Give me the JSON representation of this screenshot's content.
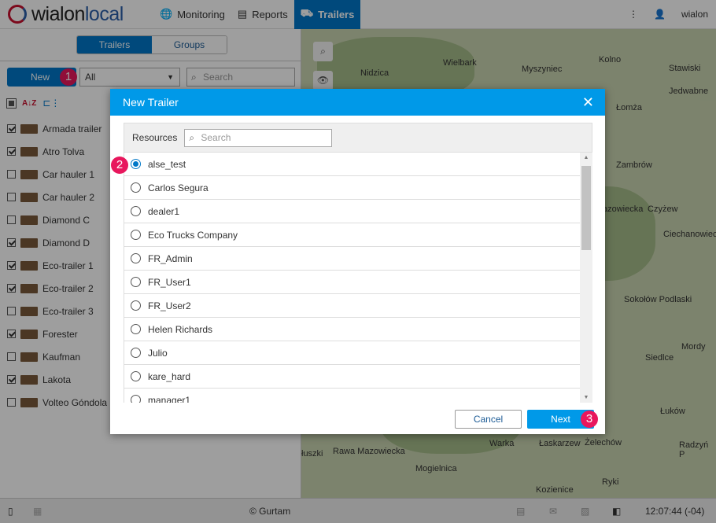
{
  "header": {
    "logo": "wialon",
    "logo_accent": "local",
    "nav": [
      {
        "label": "Monitoring",
        "icon": "globe-icon"
      },
      {
        "label": "Reports",
        "icon": "clipboard-icon"
      },
      {
        "label": "Trailers",
        "icon": "trailer-icon"
      }
    ],
    "user": "wialon"
  },
  "panel": {
    "tabs": [
      "Trailers",
      "Groups"
    ],
    "new_label": "New",
    "filter": "All",
    "search_placeholder": "Search",
    "items": [
      {
        "name": "Armada trailer",
        "checked": true
      },
      {
        "name": "Atro Tolva",
        "checked": true
      },
      {
        "name": "Car hauler 1",
        "checked": false
      },
      {
        "name": "Car hauler 2",
        "checked": false
      },
      {
        "name": "Diamond C",
        "checked": false
      },
      {
        "name": "Diamond D",
        "checked": true
      },
      {
        "name": "Eco-trailer 1",
        "checked": true
      },
      {
        "name": "Eco-trailer 2",
        "checked": true
      },
      {
        "name": "Eco-trailer 3",
        "checked": false
      },
      {
        "name": "Forester",
        "checked": true
      },
      {
        "name": "Kaufman",
        "checked": false
      },
      {
        "name": "Lakota",
        "checked": true
      },
      {
        "name": "Volteo Góndola",
        "checked": false
      }
    ]
  },
  "map": {
    "labels": [
      "Nidzica",
      "Wielbark",
      "Myszyniec",
      "Kolno",
      "Stawiski",
      "Jedwabne",
      "Łomża",
      "Zambrów",
      "azowiecka",
      "Czyżew",
      "Ciechanowiec",
      "Sokołów Podlaski",
      "Mordy",
      "Siedlce",
      "Łuków",
      "Radzyń P",
      "Żelechów",
      "Łaskarzew",
      "Warka",
      "Rawa Mazowiecka",
      "łuszki",
      "Mogielnica",
      "Ryki",
      "Kozienice"
    ]
  },
  "modal": {
    "title": "New Trailer",
    "resources_label": "Resources",
    "search_placeholder": "Search",
    "resources": [
      "alse_test",
      "Carlos Segura",
      "dealer1",
      "Eco Trucks Company",
      "FR_Admin",
      "FR_User1",
      "FR_User2",
      "Helen Richards",
      "Julio",
      "kare_hard",
      "manager1"
    ],
    "selected": "alse_test",
    "cancel": "Cancel",
    "next": "Next"
  },
  "badges": [
    "1",
    "2",
    "3"
  ],
  "footer": {
    "copyright": "© Gurtam",
    "time": "12:07:44 (-04)"
  }
}
